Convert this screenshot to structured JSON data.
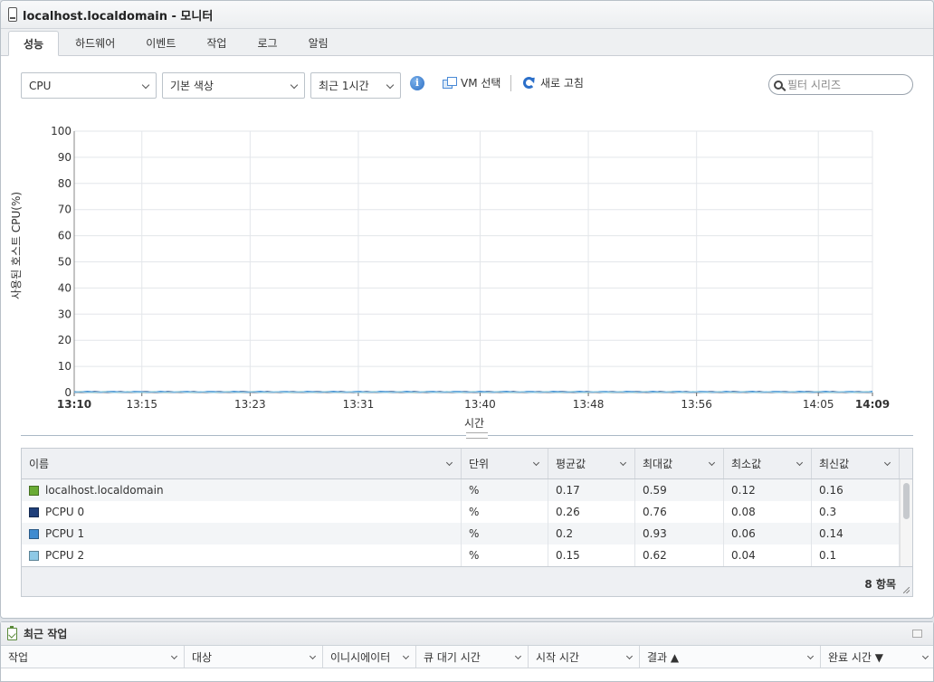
{
  "window": {
    "title": "localhost.localdomain - 모니터"
  },
  "tabs": [
    {
      "label": "성능",
      "active": true
    },
    {
      "label": "하드웨어",
      "active": false
    },
    {
      "label": "이벤트",
      "active": false
    },
    {
      "label": "작업",
      "active": false
    },
    {
      "label": "로그",
      "active": false
    },
    {
      "label": "알림",
      "active": false
    }
  ],
  "toolbar": {
    "metric_select": "CPU",
    "color_select": "기본 색상",
    "range_select": "최근 1시간",
    "info_icon": "i",
    "vm_select_label": "VM 선택",
    "refresh_label": "새로 고침",
    "filter_placeholder": "필터 시리즈"
  },
  "chart_data": {
    "type": "line",
    "ylabel": "사용된 호스트 CPU(%)",
    "xlabel": "시간",
    "ylim": [
      0,
      100
    ],
    "yticks": [
      "0",
      "10",
      "20",
      "30",
      "40",
      "50",
      "60",
      "70",
      "80",
      "90",
      "100"
    ],
    "xticks": [
      "13:10",
      "13:15",
      "13:23",
      "13:31",
      "13:40",
      "13:48",
      "13:56",
      "14:05",
      "14:09"
    ],
    "bold_xticks": [
      "13:10",
      "14:09"
    ],
    "grid": true,
    "series": [
      {
        "name": "localhost.localdomain",
        "color": "#6aab35",
        "avg": 0.17,
        "max": 0.59,
        "min": 0.12,
        "latest": 0.16
      },
      {
        "name": "PCPU 0",
        "color": "#1f3f7a",
        "avg": 0.26,
        "max": 0.76,
        "min": 0.08,
        "latest": 0.3
      },
      {
        "name": "PCPU 1",
        "color": "#3f8bd0",
        "avg": 0.2,
        "max": 0.93,
        "min": 0.06,
        "latest": 0.14
      },
      {
        "name": "PCPU 2",
        "color": "#8ec9e6",
        "avg": 0.15,
        "max": 0.62,
        "min": 0.04,
        "latest": 0.1
      }
    ]
  },
  "grid": {
    "headers": [
      "이름",
      "단위",
      "평균값",
      "최대값",
      "최소값",
      "최신값"
    ],
    "rows": [
      {
        "name": "localhost.localdomain",
        "unit": "%",
        "avg": "0.17",
        "max": "0.59",
        "min": "0.12",
        "latest": "0.16",
        "color": "#6aab35"
      },
      {
        "name": "PCPU 0",
        "unit": "%",
        "avg": "0.26",
        "max": "0.76",
        "min": "0.08",
        "latest": "0.3",
        "color": "#1f3f7a"
      },
      {
        "name": "PCPU 1",
        "unit": "%",
        "avg": "0.2",
        "max": "0.93",
        "min": "0.06",
        "latest": "0.14",
        "color": "#3f8bd0"
      },
      {
        "name": "PCPU 2",
        "unit": "%",
        "avg": "0.15",
        "max": "0.62",
        "min": "0.04",
        "latest": "0.1",
        "color": "#8ec9e6"
      }
    ],
    "footer_count": "8 항목"
  },
  "recent_tasks": {
    "title": "최근 작업",
    "columns": [
      "작업",
      "대상",
      "이니시에이터",
      "큐 대기 시간",
      "시작 시간",
      "결과 ▲",
      "완료 시간 ▼"
    ]
  }
}
